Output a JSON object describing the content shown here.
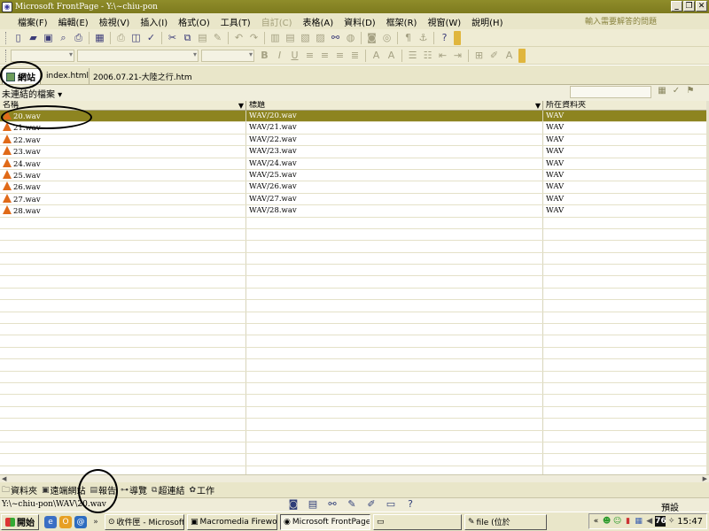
{
  "window": {
    "title": "Microsoft FrontPage - Y:\\~chiu-pon",
    "controls": [
      "_",
      "❐",
      "✕"
    ]
  },
  "menubar": {
    "items": [
      {
        "label": "檔案(F)",
        "enabled": true
      },
      {
        "label": "編輯(E)",
        "enabled": true
      },
      {
        "label": "檢視(V)",
        "enabled": true
      },
      {
        "label": "插入(I)",
        "enabled": true
      },
      {
        "label": "格式(O)",
        "enabled": true
      },
      {
        "label": "工具(T)",
        "enabled": true
      },
      {
        "label": "自訂(C)",
        "enabled": false
      },
      {
        "label": "表格(A)",
        "enabled": true
      },
      {
        "label": "資料(D)",
        "enabled": true
      },
      {
        "label": "框架(R)",
        "enabled": true
      },
      {
        "label": "視窗(W)",
        "enabled": true
      },
      {
        "label": "說明(H)",
        "enabled": true
      }
    ],
    "help_placeholder": "輸入需要解答的問題"
  },
  "tabs": [
    {
      "label": "網站",
      "active": true
    },
    {
      "label": "index.html",
      "active": false
    },
    {
      "label": "2006.07.21-大陸之行.htm",
      "active": false
    }
  ],
  "folder_view": {
    "title": "未連結的檔案 ▾"
  },
  "grid": {
    "columns": [
      "名稱",
      "標題",
      "所在資料夾"
    ],
    "rows": [
      {
        "name": "20.wav",
        "title": "WAV/20.wav",
        "folder": "WAV",
        "selected": true
      },
      {
        "name": "21.wav",
        "title": "WAV/21.wav",
        "folder": "WAV",
        "selected": false
      },
      {
        "name": "22.wav",
        "title": "WAV/22.wav",
        "folder": "WAV",
        "selected": false
      },
      {
        "name": "23.wav",
        "title": "WAV/23.wav",
        "folder": "WAV",
        "selected": false
      },
      {
        "name": "24.wav",
        "title": "WAV/24.wav",
        "folder": "WAV",
        "selected": false
      },
      {
        "name": "25.wav",
        "title": "WAV/25.wav",
        "folder": "WAV",
        "selected": false
      },
      {
        "name": "26.wav",
        "title": "WAV/26.wav",
        "folder": "WAV",
        "selected": false
      },
      {
        "name": "27.wav",
        "title": "WAV/27.wav",
        "folder": "WAV",
        "selected": false
      },
      {
        "name": "28.wav",
        "title": "WAV/28.wav",
        "folder": "WAV",
        "selected": false
      }
    ]
  },
  "view_bar": {
    "items": [
      {
        "label": "資料夾",
        "icon": "folder-icon"
      },
      {
        "label": "遠端網站",
        "icon": "remote-site-icon"
      },
      {
        "label": "報告",
        "icon": "report-icon"
      },
      {
        "label": "導覽",
        "icon": "navigation-icon"
      },
      {
        "label": "超連結",
        "icon": "hyperlink-icon"
      },
      {
        "label": "工作",
        "icon": "tasks-icon"
      }
    ]
  },
  "statusbar": {
    "path": "Y:\\~chiu-pon\\WAV\\20.wav",
    "mode": "預設"
  },
  "taskbar": {
    "start_label": "開始",
    "buttons": [
      {
        "label": "收件匣 - Microsoft ...",
        "active": false
      },
      {
        "label": "Macromedia Firewo...",
        "active": false
      },
      {
        "label": "Microsoft FrontPage...",
        "active": true
      },
      {
        "label": "",
        "active": false
      },
      {
        "label": "file (位於",
        "active": false
      }
    ],
    "tray_badge": "76",
    "clock": "15:47"
  },
  "colors": {
    "title_bar": "#7d7a1e",
    "selection": "#8d8420",
    "chrome": "#e9e6c9",
    "wav_icon": "#e06a18"
  }
}
